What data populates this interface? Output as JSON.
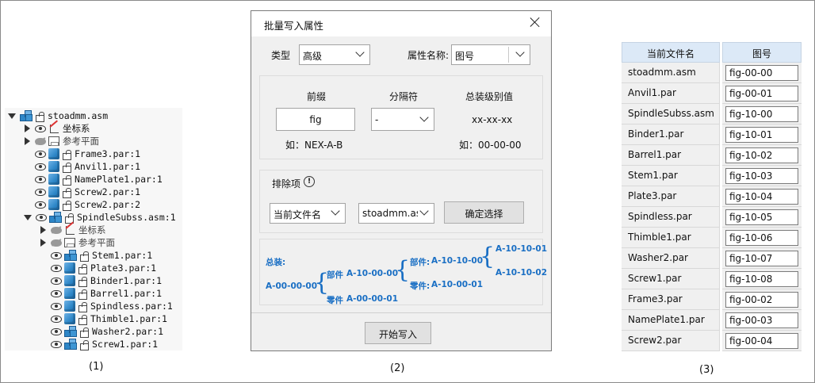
{
  "tree": {
    "rows": [
      {
        "label": "stoadmm.asm",
        "expand": "down",
        "eye": false,
        "icon": "cubes",
        "lock": true,
        "indent": 0
      },
      {
        "label": "坐标系",
        "expand": "right",
        "eye": true,
        "icon": "coord",
        "lock": false,
        "indent": 1
      },
      {
        "label": "参考平面",
        "expand": "right",
        "eye": "off",
        "icon": "plane",
        "lock": false,
        "indent": 1,
        "gray": true
      },
      {
        "label": "Frame3.par:1",
        "expand": "none",
        "eye": true,
        "icon": "cube",
        "lock": true,
        "indent": 1
      },
      {
        "label": "Anvil1.par:1",
        "expand": "none",
        "eye": true,
        "icon": "cube",
        "lock": true,
        "indent": 1
      },
      {
        "label": "NamePlate1.par:1",
        "expand": "none",
        "eye": true,
        "icon": "cube",
        "lock": true,
        "indent": 1
      },
      {
        "label": "Screw2.par:1",
        "expand": "none",
        "eye": true,
        "icon": "cube",
        "lock": true,
        "indent": 1
      },
      {
        "label": "Screw2.par:2",
        "expand": "none",
        "eye": true,
        "icon": "cube",
        "lock": true,
        "indent": 1
      },
      {
        "label": "SpindleSubss.asm:1",
        "expand": "down",
        "eye": true,
        "icon": "cubes",
        "lock": true,
        "indent": 1
      },
      {
        "label": "坐标系",
        "expand": "right",
        "eye": "off",
        "icon": "coord",
        "lock": false,
        "indent": 2,
        "gray": true
      },
      {
        "label": "参考平面",
        "expand": "right",
        "eye": "off",
        "icon": "plane",
        "lock": false,
        "indent": 2,
        "gray": true
      },
      {
        "label": "Stem1.par:1",
        "expand": "none",
        "eye": true,
        "icon": "cubes",
        "lock": true,
        "indent": 2
      },
      {
        "label": "Plate3.par:1",
        "expand": "none",
        "eye": true,
        "icon": "cube",
        "lock": true,
        "indent": 2
      },
      {
        "label": "Binder1.par:1",
        "expand": "none",
        "eye": true,
        "icon": "cube",
        "lock": true,
        "indent": 2
      },
      {
        "label": "Barrel1.par:1",
        "expand": "none",
        "eye": true,
        "icon": "cube",
        "lock": true,
        "indent": 2
      },
      {
        "label": "Spindless.par:1",
        "expand": "none",
        "eye": true,
        "icon": "cube",
        "lock": true,
        "indent": 2
      },
      {
        "label": "Thimble1.par:1",
        "expand": "none",
        "eye": true,
        "icon": "cube",
        "lock": true,
        "indent": 2
      },
      {
        "label": "Washer2.par:1",
        "expand": "none",
        "eye": true,
        "icon": "cubes",
        "lock": true,
        "indent": 2
      },
      {
        "label": "Screw1.par:1",
        "expand": "none",
        "eye": true,
        "icon": "cubes",
        "lock": true,
        "indent": 2
      }
    ]
  },
  "captions": {
    "one": "(1)",
    "two": "(2)",
    "three": "(3)"
  },
  "dialog": {
    "title": "批量写入属性",
    "type_label": "类型",
    "type_value": "高级",
    "attr_name_label": "属性名称:",
    "attr_name_value": "图号",
    "prefix_label": "前缀",
    "prefix_value": "fig",
    "prefix_example": "如：NEX-A-B",
    "separator_label": "分隔符",
    "separator_value": "-",
    "level_label": "总装级别值",
    "level_value": "xx-xx-xx",
    "level_example": "如：00-00-00",
    "exclude_label": "排除项",
    "exclude_info_icon": "!",
    "exclude_field_value": "当前文件名",
    "exclude_file_value": "stoadmm.as",
    "confirm_button": "确定选择",
    "start_button": "开始写入",
    "example": {
      "assembly_label": "总装:",
      "root": "A-00-00-00",
      "part_label_1": "部件",
      "part_value_1": "A-10-00-00",
      "piece_label_1": "零件",
      "piece_value_1": "A-00-00-01",
      "part_label_2": "部件:",
      "part_value_2": "A-10-10-00",
      "piece_label_2": "零件:",
      "piece_value_2": "A-10-00-01",
      "leaf_1": "A-10-10-01",
      "leaf_2": "A-10-10-02"
    }
  },
  "table": {
    "headers": [
      "当前文件名",
      "图号"
    ],
    "rows": [
      [
        "stoadmm.asm",
        "fig-00-00"
      ],
      [
        "Anvil1.par",
        "fig-00-01"
      ],
      [
        "SpindleSubss.asm",
        "fig-10-00"
      ],
      [
        "Binder1.par",
        "fig-10-01"
      ],
      [
        "Barrel1.par",
        "fig-10-02"
      ],
      [
        "Stem1.par",
        "fig-10-03"
      ],
      [
        "Plate3.par",
        "fig-10-04"
      ],
      [
        "Spindless.par",
        "fig-10-05"
      ],
      [
        "Thimble1.par",
        "fig-10-06"
      ],
      [
        "Washer2.par",
        "fig-10-07"
      ],
      [
        "Screw1.par",
        "fig-10-08"
      ],
      [
        "Frame3.par",
        "fig-00-02"
      ],
      [
        "NamePlate1.par",
        "fig-00-03"
      ],
      [
        "Screw2.par",
        "fig-00-04"
      ]
    ]
  }
}
